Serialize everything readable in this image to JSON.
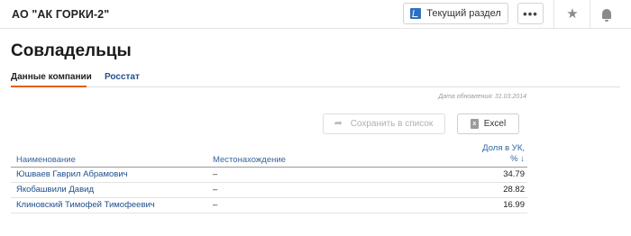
{
  "header": {
    "company_name": "АО \"АК ГОРКИ-2\"",
    "current_section_label": "Текущий раздел",
    "more_label": "•••"
  },
  "page": {
    "title": "Совладельцы",
    "tabs": [
      {
        "label": "Данные компании",
        "active": true
      },
      {
        "label": "Росстат",
        "active": false
      }
    ],
    "update_date": "Дата обновления: 31.03.2014"
  },
  "actions": {
    "save_label": "Сохранить в список",
    "excel_label": "Excel",
    "excel_icon_text": "x"
  },
  "table": {
    "columns": {
      "name": "Наименование",
      "location": "Местонахождение",
      "share_line1": "Доля в УК,",
      "share_line2": "% ↓"
    },
    "rows": [
      {
        "name": "Юшваев Гаврил Абрамович",
        "location": "–",
        "share": "34.79"
      },
      {
        "name": "Якобашвили Давид",
        "location": "–",
        "share": "28.82"
      },
      {
        "name": "Клиновский Тимофей Тимофеевич",
        "location": "–",
        "share": "16.99"
      }
    ]
  },
  "colors": {
    "accent": "#e05f1a",
    "link": "#1f4f8d",
    "brand_icon": "#2f6fc1"
  },
  "icons": {
    "section": "bookmark-icon",
    "favorite": "star-icon",
    "notifications": "bell-icon"
  }
}
